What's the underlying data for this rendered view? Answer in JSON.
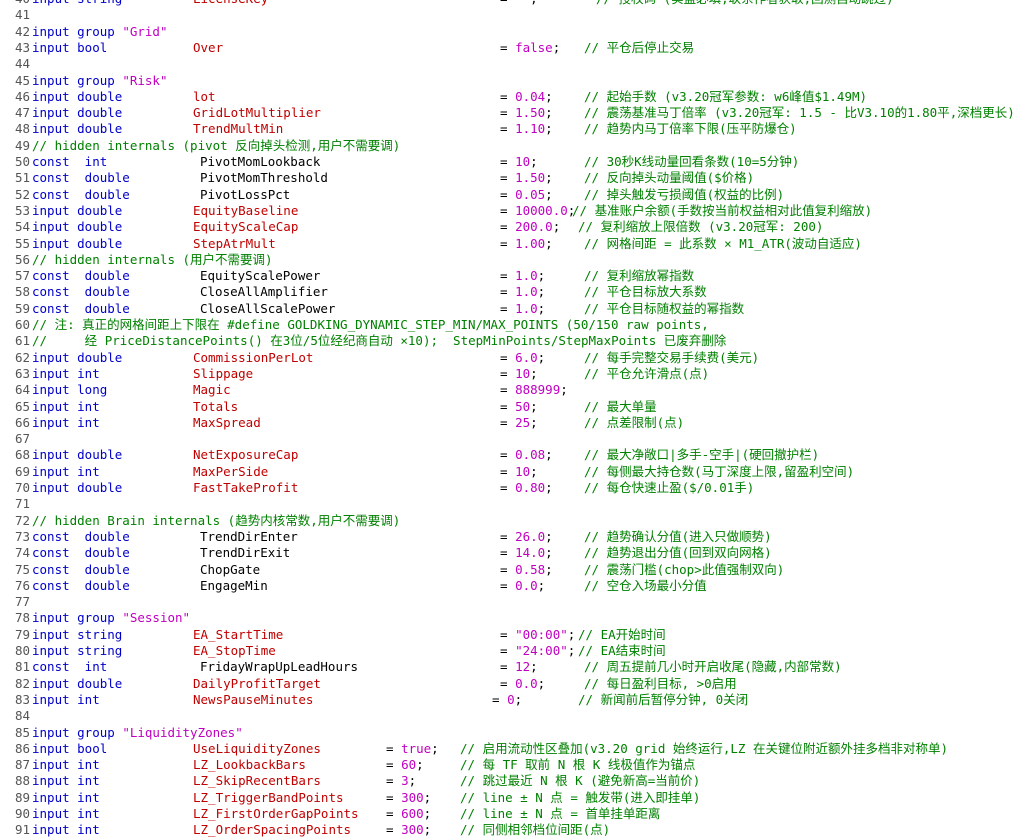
{
  "lines": [
    {
      "n": "40",
      "kind": "var",
      "kw": "input string",
      "id": "LicenseKey",
      "eqx": 500,
      "val": "\"\"",
      "semi": ";",
      "cmx": 596,
      "cm": "// 授权码 (实盘必填,联系作者获取;回测自动跳过)"
    },
    {
      "n": "41",
      "kind": "blank"
    },
    {
      "n": "42",
      "kind": "group",
      "kw": "input group",
      "str": "\"Grid\""
    },
    {
      "n": "43",
      "kind": "var",
      "kw": "input bool",
      "id": "Over",
      "eqx": 500,
      "val": "false",
      "semi": ";",
      "cmx": 584,
      "cm": "// 平仓后停止交易"
    },
    {
      "n": "44",
      "kind": "blank"
    },
    {
      "n": "45",
      "kind": "group",
      "kw": "input group",
      "str": "\"Risk\""
    },
    {
      "n": "46",
      "kind": "var",
      "kw": "input double",
      "id": "lot",
      "eqx": 500,
      "val": "0.04",
      "semi": ";",
      "cmx": 584,
      "cm": "// 起始手数 (v3.20冠军参数: w6峰值$1.49M)"
    },
    {
      "n": "47",
      "kind": "var",
      "kw": "input double",
      "id": "GridLotMultiplier",
      "eqx": 500,
      "val": "1.50",
      "semi": ";",
      "cmx": 584,
      "cm": "// 震荡基准马丁倍率 (v3.20冠军: 1.5 - 比V3.10的1.80平,深档更长)"
    },
    {
      "n": "48",
      "kind": "var",
      "kw": "input double",
      "id": "TrendMultMin",
      "eqx": 500,
      "val": "1.10",
      "semi": ";",
      "cmx": 584,
      "cm": "// 趋势内马丁倍率下限(压平防爆仓)"
    },
    {
      "n": "49",
      "kind": "comment",
      "text": "// hidden internals (pivot 反向掉头检测,用户不需要调)"
    },
    {
      "n": "50",
      "kind": "const",
      "kw": "const  int",
      "id": "PivotMomLookback",
      "eqx": 500,
      "val": "10",
      "semi": ";",
      "cmx": 584,
      "cm": "// 30秒K线动量回看条数(10=5分钟)"
    },
    {
      "n": "51",
      "kind": "const",
      "kw": "const  double",
      "id": "PivotMomThreshold",
      "eqx": 500,
      "val": "1.50",
      "semi": ";",
      "cmx": 584,
      "cm": "// 反向掉头动量阈值($价格)"
    },
    {
      "n": "52",
      "kind": "const",
      "kw": "const  double",
      "id": "PivotLossPct",
      "eqx": 500,
      "val": "0.05",
      "semi": ";",
      "cmx": 584,
      "cm": "// 掉头触发亏损阈值(权益的比例)"
    },
    {
      "n": "53",
      "kind": "var",
      "kw": "input double",
      "id": "EquityBaseline",
      "eqx": 500,
      "val": "10000.0",
      "semi": ";",
      "cmx": 572,
      "cm": "// 基准账户余额(手数按当前权益相对此值复利缩放)"
    },
    {
      "n": "54",
      "kind": "var",
      "kw": "input double",
      "id": "EquityScaleCap",
      "eqx": 500,
      "val": "200.0",
      "semi": ";",
      "cmx": 578,
      "cm": "// 复利缩放上限倍数 (v3.20冠军: 200)"
    },
    {
      "n": "55",
      "kind": "var",
      "kw": "input double",
      "id": "StepAtrMult",
      "eqx": 500,
      "val": "1.00",
      "semi": ";",
      "cmx": 584,
      "cm": "// 网格间距 = 此系数 × M1_ATR(波动自适应)"
    },
    {
      "n": "56",
      "kind": "comment",
      "text": "// hidden internals (用户不需要调)"
    },
    {
      "n": "57",
      "kind": "const",
      "kw": "const  double",
      "id": "EquityScalePower",
      "eqx": 500,
      "val": "1.0",
      "semi": ";",
      "cmx": 584,
      "cm": "// 复利缩放幂指数"
    },
    {
      "n": "58",
      "kind": "const",
      "kw": "const  double",
      "id": "CloseAllAmplifier",
      "eqx": 500,
      "val": "1.0",
      "semi": ";",
      "cmx": 584,
      "cm": "// 平仓目标放大系数"
    },
    {
      "n": "59",
      "kind": "const",
      "kw": "const  double",
      "id": "CloseAllScalePower",
      "eqx": 500,
      "val": "1.0",
      "semi": ";",
      "cmx": 584,
      "cm": "// 平仓目标随权益的幂指数"
    },
    {
      "n": "60",
      "kind": "comment",
      "text": "// 注: 真正的网格间距上下限在 #define GOLDKING_DYNAMIC_STEP_MIN/MAX_POINTS (50/150 raw points,"
    },
    {
      "n": "61",
      "kind": "comment",
      "text": "//     经 PriceDistancePoints() 在3位/5位经纪商自动 ×10);  StepMinPoints/StepMaxPoints 已废弃删除"
    },
    {
      "n": "62",
      "kind": "var",
      "kw": "input double",
      "id": "CommissionPerLot",
      "eqx": 500,
      "val": "6.0",
      "semi": ";",
      "cmx": 584,
      "cm": "// 每手完整交易手续费(美元)"
    },
    {
      "n": "63",
      "kind": "var",
      "kw": "input int",
      "id": "Slippage",
      "eqx": 500,
      "val": "10",
      "semi": ";",
      "cmx": 584,
      "cm": "// 平仓允许滑点(点)"
    },
    {
      "n": "64",
      "kind": "var",
      "kw": "input long",
      "id": "Magic",
      "eqx": 500,
      "val": "888999",
      "semi": ";",
      "cmx": 0,
      "cm": ""
    },
    {
      "n": "65",
      "kind": "var",
      "kw": "input int",
      "id": "Totals",
      "eqx": 500,
      "val": "50",
      "semi": ";",
      "cmx": 584,
      "cm": "// 最大单量"
    },
    {
      "n": "66",
      "kind": "var",
      "kw": "input int",
      "id": "MaxSpread",
      "eqx": 500,
      "val": "25",
      "semi": ";",
      "cmx": 584,
      "cm": "// 点差限制(点)"
    },
    {
      "n": "67",
      "kind": "blank"
    },
    {
      "n": "68",
      "kind": "var",
      "kw": "input double",
      "id": "NetExposureCap",
      "eqx": 500,
      "val": "0.08",
      "semi": ";",
      "cmx": 584,
      "cm": "// 最大净敞口|多手-空手|(硬回撤护栏)"
    },
    {
      "n": "69",
      "kind": "var",
      "kw": "input int",
      "id": "MaxPerSide",
      "eqx": 500,
      "val": "10",
      "semi": ";",
      "cmx": 584,
      "cm": "// 每侧最大持仓数(马丁深度上限,留盈利空间)"
    },
    {
      "n": "70",
      "kind": "var",
      "kw": "input double",
      "id": "FastTakeProfit",
      "eqx": 500,
      "val": "0.80",
      "semi": ";",
      "cmx": 584,
      "cm": "// 每仓快速止盈($/0.01手)"
    },
    {
      "n": "71",
      "kind": "blank"
    },
    {
      "n": "72",
      "kind": "comment",
      "text": "// hidden Brain internals (趋势内核常数,用户不需要调)"
    },
    {
      "n": "73",
      "kind": "const",
      "kw": "const  double",
      "id": "TrendDirEnter",
      "eqx": 500,
      "val": "26.0",
      "semi": ";",
      "cmx": 584,
      "cm": "// 趋势确认分值(进入只做顺势)"
    },
    {
      "n": "74",
      "kind": "const",
      "kw": "const  double",
      "id": "TrendDirExit",
      "eqx": 500,
      "val": "14.0",
      "semi": ";",
      "cmx": 584,
      "cm": "// 趋势退出分值(回到双向网格)"
    },
    {
      "n": "75",
      "kind": "const",
      "kw": "const  double",
      "id": "ChopGate",
      "eqx": 500,
      "val": "0.58",
      "semi": ";",
      "cmx": 584,
      "cm": "// 震荡门槛(chop>此值强制双向)"
    },
    {
      "n": "76",
      "kind": "const",
      "kw": "const  double",
      "id": "EngageMin",
      "eqx": 500,
      "val": "0.0",
      "semi": ";",
      "cmx": 584,
      "cm": "// 空仓入场最小分值"
    },
    {
      "n": "77",
      "kind": "blank"
    },
    {
      "n": "78",
      "kind": "group",
      "kw": "input group",
      "str": "\"Session\""
    },
    {
      "n": "79",
      "kind": "var",
      "kw": "input string",
      "id": "EA_StartTime",
      "eqx": 500,
      "val": "\"00:00\"",
      "semi": ";",
      "cmx": 578,
      "cm": "// EA开始时间"
    },
    {
      "n": "80",
      "kind": "var",
      "kw": "input string",
      "id": "EA_StopTime",
      "eqx": 500,
      "val": "\"24:00\"",
      "semi": ";",
      "cmx": 578,
      "cm": "// EA结束时间"
    },
    {
      "n": "81",
      "kind": "const",
      "kw": "const  int",
      "id": "FridayWrapUpLeadHours",
      "eqx": 500,
      "val": "12",
      "semi": ";",
      "cmx": 584,
      "cm": "// 周五提前几小时开启收尾(隐藏,内部常数)"
    },
    {
      "n": "82",
      "kind": "var",
      "kw": "input double",
      "id": "DailyProfitTarget",
      "eqx": 500,
      "val": "0.0",
      "semi": ";",
      "cmx": 584,
      "cm": "// 每日盈利目标, >0启用"
    },
    {
      "n": "83",
      "kind": "var",
      "kw": "input int",
      "id": "NewsPauseMinutes",
      "eqx": 492,
      "val": "0",
      "semi": ";",
      "cmx": 578,
      "cm": "// 新闻前后暂停分钟, 0关闭"
    },
    {
      "n": "84",
      "kind": "blank"
    },
    {
      "n": "85",
      "kind": "group",
      "kw": "input group",
      "str": "\"LiquidityZones\""
    },
    {
      "n": "86",
      "kind": "var",
      "kw": "input bool",
      "id": "UseLiquidityZones",
      "eqx": 386,
      "val": "true",
      "semi": ";",
      "cmx": 460,
      "cm": "// 启用流动性区叠加(v3.20 grid 始终运行,LZ 在关键位附近额外挂多档非对称单)"
    },
    {
      "n": "87",
      "kind": "var",
      "kw": "input int",
      "id": "LZ_LookbackBars",
      "eqx": 386,
      "val": "60",
      "semi": ";",
      "cmx": 460,
      "cm": "// 每 TF 取前 N 根 K 线极值作为锚点"
    },
    {
      "n": "88",
      "kind": "var",
      "kw": "input int",
      "id": "LZ_SkipRecentBars",
      "eqx": 386,
      "val": "3",
      "semi": ";",
      "cmx": 460,
      "cm": "// 跳过最近 N 根 K (避免新高=当前价)"
    },
    {
      "n": "89",
      "kind": "var",
      "kw": "input int",
      "id": "LZ_TriggerBandPoints",
      "eqx": 386,
      "val": "300",
      "semi": ";",
      "cmx": 460,
      "cm": "// line ± N 点 = 触发带(进入即挂单)"
    },
    {
      "n": "90",
      "kind": "var",
      "kw": "input int",
      "id": "LZ_FirstOrderGapPoints",
      "eqx": 386,
      "val": "600",
      "semi": ";",
      "cmx": 460,
      "cm": "// line ± N 点 = 首单挂单距离"
    },
    {
      "n": "91",
      "kind": "var",
      "kw": "input int",
      "id": "LZ_OrderSpacingPoints",
      "eqx": 386,
      "val": "300",
      "semi": ";",
      "cmx": 460,
      "cm": "// 同侧相邻档位间距(点)"
    }
  ]
}
